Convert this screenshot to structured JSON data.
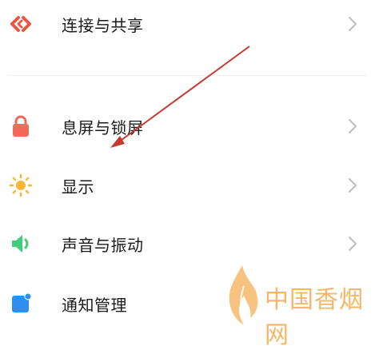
{
  "settings": {
    "items": [
      {
        "label": "连接与共享",
        "icon": "connection-share-icon"
      },
      {
        "label": "息屏与锁屏",
        "icon": "lock-icon"
      },
      {
        "label": "显示",
        "icon": "sun-icon"
      },
      {
        "label": "声音与振动",
        "icon": "speaker-icon"
      },
      {
        "label": "通知管理",
        "icon": "notification-icon"
      }
    ]
  },
  "watermark": {
    "text": "中国香烟网"
  },
  "colors": {
    "connection": "#ec5540",
    "lock": "#f26a5a",
    "sun": "#f7b733",
    "speaker": "#3fcd7a",
    "notification": "#2f8ff0",
    "chevron": "#bdbdbd",
    "arrow": "#c8382f"
  }
}
